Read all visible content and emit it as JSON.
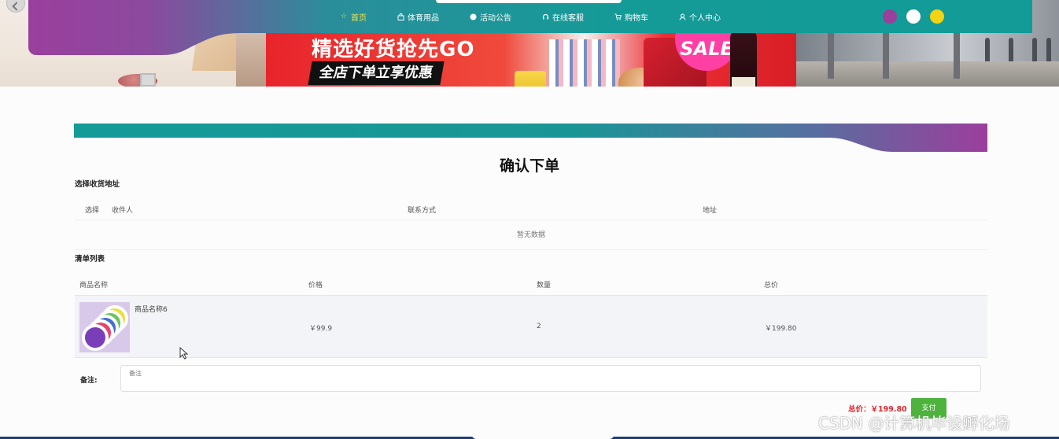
{
  "nav": {
    "items": [
      {
        "label": "首页",
        "icon": "star-icon",
        "active": true
      },
      {
        "label": "体育用品",
        "icon": "bag-icon",
        "active": false
      },
      {
        "label": "活动公告",
        "icon": "dot-icon",
        "active": false
      },
      {
        "label": "在线客服",
        "icon": "headset-icon",
        "active": false
      },
      {
        "label": "购物车",
        "icon": "cart-icon",
        "active": false
      },
      {
        "label": "个人中心",
        "icon": "user-icon",
        "active": false
      }
    ],
    "theme_colors": [
      "#9b3f9c",
      "#ffffff",
      "#f3d313"
    ],
    "active_color": "#f6e23a"
  },
  "banner": {
    "headline": "精选好货抢先GO",
    "subline": "全店下单立享优惠",
    "sale_badge": "SALE"
  },
  "page": {
    "title": "确认下单",
    "address_section": "选择收货地址",
    "address_table": {
      "headers": [
        "选择",
        "收件人",
        "联系方式",
        "地址"
      ],
      "empty_text": "暂无数据"
    },
    "order_section": "清单列表",
    "order_table": {
      "headers": [
        "商品名称",
        "价格",
        "数量",
        "总价"
      ],
      "rows": [
        {
          "name": "商品名称6",
          "price": "￥99.9",
          "qty": "2",
          "total": "￥199.80"
        }
      ]
    },
    "remark_label": "备注:",
    "remark_placeholder": "备注",
    "total_text": "总价：￥199.80",
    "pay_label": "支付"
  },
  "watermark": "CSDN @计算机毕设孵化场"
}
